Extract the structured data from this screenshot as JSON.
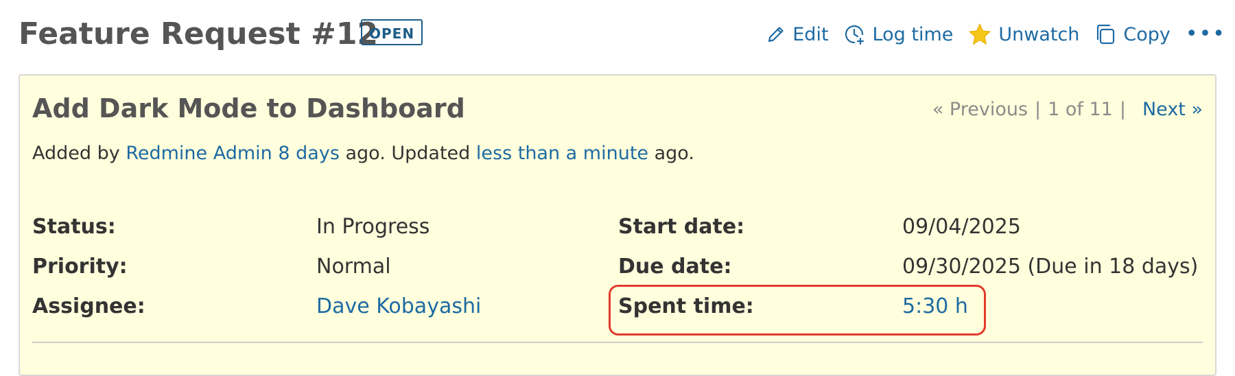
{
  "issue": {
    "title": "Feature Request #12",
    "status_badge": "OPEN",
    "subject": "Add Dark Mode to Dashboard"
  },
  "actions": {
    "edit": "Edit",
    "log_time": "Log time",
    "unwatch": "Unwatch",
    "copy": "Copy",
    "more": "•••"
  },
  "pager": {
    "previous": "« Previous",
    "sep1": "|",
    "position": "1 of 11",
    "sep2": "|",
    "next": "Next »"
  },
  "author_line": {
    "prefix": "Added by",
    "author": "Redmine Admin",
    "added_ago": "8 days",
    "middle": "ago. Updated",
    "updated_ago": "less than a minute",
    "suffix": "ago."
  },
  "attributes": {
    "status": {
      "label": "Status:",
      "value": "In Progress"
    },
    "priority": {
      "label": "Priority:",
      "value": "Normal"
    },
    "assignee": {
      "label": "Assignee:",
      "value": "Dave Kobayashi"
    },
    "start_date": {
      "label": "Start date:",
      "value": "09/04/2025"
    },
    "due_date": {
      "label": "Due date:",
      "value": "09/30/2025 (Due in 18 days)"
    },
    "spent_time": {
      "label": "Spent time:",
      "value": "5:30 h"
    }
  },
  "colors": {
    "link": "#1d6aa3",
    "box_background": "#ffffdd",
    "highlight": "#e23a2a",
    "star": "#f5c518"
  },
  "icons": {
    "edit": "pencil-icon",
    "log_time": "clock-plus-icon",
    "unwatch": "star-icon",
    "copy": "copy-icon",
    "more": "ellipsis-icon"
  }
}
